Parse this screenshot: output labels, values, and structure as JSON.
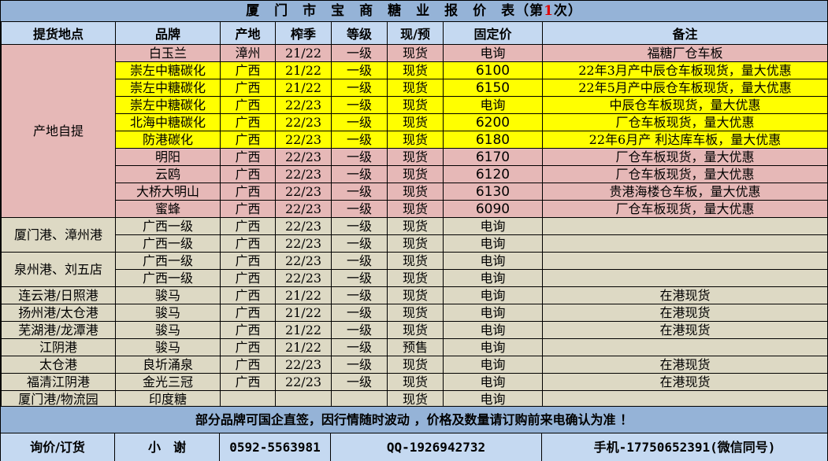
{
  "title": {
    "main": "厦　门　市　宝　商　糖　业　报　价　表",
    "open": "（第",
    "num": "1",
    "close": "次）"
  },
  "headers": [
    "提货地点",
    "品牌",
    "产地",
    "榨季",
    "等级",
    "现/预",
    "固定价",
    "备注"
  ],
  "groups": [
    {
      "location": "产地自提",
      "style": "pink",
      "rows": [
        {
          "brand": "白玉兰",
          "origin": "漳州",
          "season": "21/22",
          "grade": "一级",
          "status": "现货",
          "price": "电询",
          "note": "福糖厂仓车板",
          "style": "pink"
        },
        {
          "brand": "崇左中糖碳化",
          "origin": "广西",
          "season": "21/22",
          "grade": "一级",
          "status": "现货",
          "price": "6100",
          "note": "22年3月产中辰仓车板现货，量大优惠",
          "style": "yellow"
        },
        {
          "brand": "崇左中糖碳化",
          "origin": "广西",
          "season": "21/22",
          "grade": "一级",
          "status": "现货",
          "price": "6150",
          "note": "22年5月产中辰仓车板现货，量大优惠",
          "style": "yellow"
        },
        {
          "brand": "崇左中糖碳化",
          "origin": "广西",
          "season": "22/23",
          "grade": "一级",
          "status": "现货",
          "price": "电询",
          "note": "中辰仓车板现货，量大优惠",
          "style": "yellow"
        },
        {
          "brand": "北海中糖碳化",
          "origin": "广西",
          "season": "22/23",
          "grade": "一级",
          "status": "现货",
          "price": "6200",
          "note": "厂仓车板现货，量大优惠",
          "style": "yellow"
        },
        {
          "brand": "防港碳化",
          "origin": "广西",
          "season": "22/23",
          "grade": "一级",
          "status": "现货",
          "price": "6180",
          "note": "22年6月产 利达库车板，量大优惠",
          "style": "yellow"
        },
        {
          "brand": "明阳",
          "origin": "广西",
          "season": "22/23",
          "grade": "一级",
          "status": "现货",
          "price": "6170",
          "note": "厂仓车板现货，量大优惠",
          "style": "pink"
        },
        {
          "brand": "云鸥",
          "origin": "广西",
          "season": "22/23",
          "grade": "一级",
          "status": "现货",
          "price": "6120",
          "note": "厂仓车板现货，量大优惠",
          "style": "pink"
        },
        {
          "brand": "大桥大明山",
          "origin": "广西",
          "season": "22/23",
          "grade": "一级",
          "status": "现货",
          "price": "6130",
          "note": "贵港海楼仓车板，量大优惠",
          "style": "pink"
        },
        {
          "brand": "蜜蜂",
          "origin": "广西",
          "season": "22/23",
          "grade": "一级",
          "status": "现货",
          "price": "6090",
          "note": "厂仓车板现货，量大优惠",
          "style": "pink"
        }
      ]
    },
    {
      "location": "厦门港、漳州港",
      "style": "tan",
      "rows": [
        {
          "brand": "广西一级",
          "origin": "广西",
          "season": "22/23",
          "grade": "一级",
          "status": "现货",
          "price": "电询",
          "note": "",
          "style": "tan"
        },
        {
          "brand": "广西一级",
          "origin": "广西",
          "season": "22/23",
          "grade": "一级",
          "status": "现货",
          "price": "电询",
          "note": "",
          "style": "tan"
        }
      ]
    },
    {
      "location": "泉州港、刘五店",
      "style": "tan",
      "rows": [
        {
          "brand": "广西一级",
          "origin": "广西",
          "season": "22/23",
          "grade": "一级",
          "status": "现货",
          "price": "电询",
          "note": "",
          "style": "tan"
        },
        {
          "brand": "广西一级",
          "origin": "广西",
          "season": "22/23",
          "grade": "一级",
          "status": "现货",
          "price": "电询",
          "note": "",
          "style": "tan"
        }
      ]
    },
    {
      "location": "连云港/日照港",
      "style": "tan",
      "rows": [
        {
          "brand": "骏马",
          "origin": "广西",
          "season": "21/22",
          "grade": "一级",
          "status": "现货",
          "price": "电询",
          "note": "在港现货",
          "style": "tan"
        }
      ]
    },
    {
      "location": "扬州港/太仓港",
      "style": "tan",
      "rows": [
        {
          "brand": "骏马",
          "origin": "广西",
          "season": "21/22",
          "grade": "一级",
          "status": "现货",
          "price": "电询",
          "note": "在港现货",
          "style": "tan"
        }
      ]
    },
    {
      "location": "芜湖港/龙潭港",
      "style": "tan",
      "rows": [
        {
          "brand": "骏马",
          "origin": "广西",
          "season": "21/22",
          "grade": "一级",
          "status": "现货",
          "price": "电询",
          "note": "在港现货",
          "style": "tan"
        }
      ]
    },
    {
      "location": "江阴港",
      "style": "tan",
      "rows": [
        {
          "brand": "骏马",
          "origin": "广西",
          "season": "21/22",
          "grade": "一级",
          "status": "预售",
          "price": "电询",
          "note": "",
          "style": "tan"
        }
      ]
    },
    {
      "location": "太仓港",
      "style": "tan",
      "rows": [
        {
          "brand": "良圻涌泉",
          "origin": "广西",
          "season": "22/23",
          "grade": "一级",
          "status": "现货",
          "price": "电询",
          "note": "在港现货",
          "style": "tan"
        }
      ]
    },
    {
      "location": "福清江阴港",
      "style": "tan",
      "rows": [
        {
          "brand": "金光三冠",
          "origin": "广西",
          "season": "22/23",
          "grade": "一级",
          "status": "现货",
          "price": "电询",
          "note": "在港现货",
          "style": "tan"
        }
      ]
    },
    {
      "location": "厦门港/物流园",
      "style": "tan",
      "rows": [
        {
          "brand": "印度糖",
          "origin": "",
          "season": "",
          "grade": "",
          "status": "现货",
          "price": "电询",
          "note": "",
          "style": "tan"
        }
      ]
    }
  ],
  "notice": "部分品牌可国企直签，因行情随时波动 ，价格及数量请订购前来电确认为准 ！",
  "contact": {
    "label": "询价/订货",
    "name": "小　谢",
    "phone": "0592-5563981",
    "qq": "QQ-1926942732",
    "mobile": "手机-17750652391(微信同号)"
  }
}
